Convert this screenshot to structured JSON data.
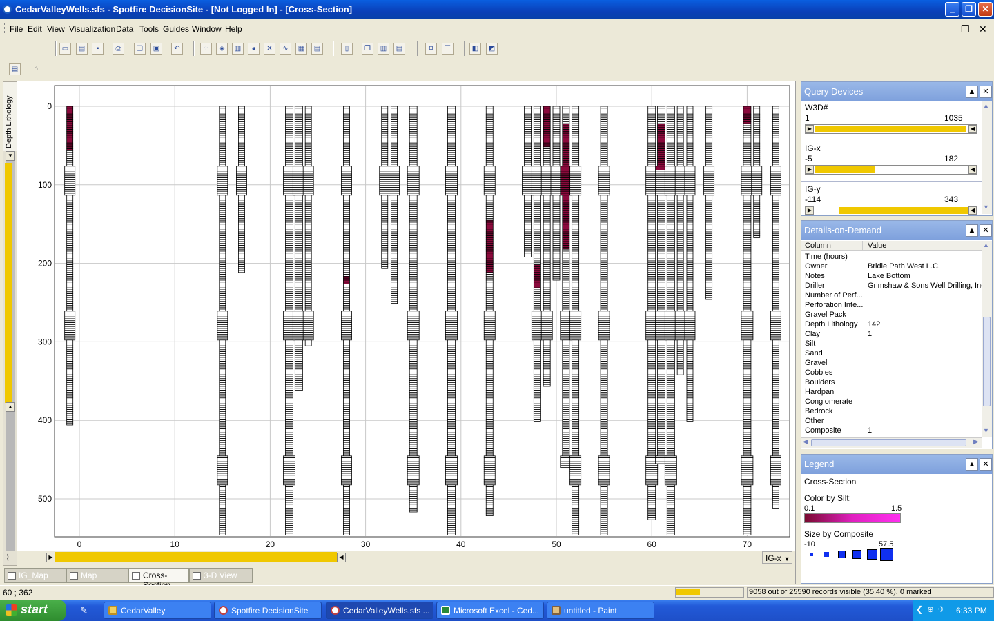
{
  "window": {
    "title": "CedarValleyWells.sfs - Spotfire DecisionSite - [Not Logged In] - [Cross-Section]"
  },
  "menu": [
    "File",
    "Edit",
    "View",
    "Visualization",
    "Data",
    "Tools",
    "Guides",
    "Window",
    "Help"
  ],
  "plot": {
    "vertical_tab": "Depth Lithology",
    "y_ticks": [
      "0",
      "100",
      "200",
      "300",
      "400",
      "500"
    ],
    "x_ticks": [
      "0",
      "10",
      "20",
      "30",
      "40",
      "50",
      "60",
      "70"
    ],
    "x_axis_selector": "IG-x",
    "colors": {
      "high_silt": "#8b0a3c",
      "grid": "#c8c8c8",
      "slider": "#f0c800"
    }
  },
  "tabs": [
    "IG_Map",
    "Map",
    "Cross-Section",
    "3-D View"
  ],
  "active_tab": "Cross-Section",
  "status": {
    "coords": "60 ; 362",
    "records": "9058 out of 25590 records visible (35.40 %), 0 marked"
  },
  "query_devices": {
    "title": "Query Devices",
    "items": [
      {
        "label": "W3D#",
        "min": "1",
        "max": "1035",
        "fill_from": 0.0,
        "fill_to": 0.99
      },
      {
        "label": "IG-x",
        "min": "-5",
        "max": "182",
        "fill_from": 0.0,
        "fill_to": 0.39
      },
      {
        "label": "IG-y",
        "min": "-114",
        "max": "343",
        "fill_from": 0.16,
        "fill_to": 1.0
      }
    ]
  },
  "details": {
    "title": "Details-on-Demand",
    "col_header": "Column",
    "val_header": "Value",
    "rows": [
      {
        "c": "Time (hours)",
        "v": ""
      },
      {
        "c": "Owner",
        "v": "Bridle Path West L.C."
      },
      {
        "c": "Notes",
        "v": "Lake Bottom"
      },
      {
        "c": "Driller",
        "v": "Grimshaw & Sons Well Drilling, Inc."
      },
      {
        "c": "Number of Perf...",
        "v": ""
      },
      {
        "c": "Perforation Inte...",
        "v": ""
      },
      {
        "c": "Gravel Pack",
        "v": ""
      },
      {
        "c": "Depth Lithology",
        "v": "142"
      },
      {
        "c": "Clay",
        "v": "1"
      },
      {
        "c": "Silt",
        "v": ""
      },
      {
        "c": "Sand",
        "v": ""
      },
      {
        "c": "Gravel",
        "v": ""
      },
      {
        "c": "Cobbles",
        "v": ""
      },
      {
        "c": "Boulders",
        "v": ""
      },
      {
        "c": "Hardpan",
        "v": ""
      },
      {
        "c": "Conglomerate",
        "v": ""
      },
      {
        "c": "Bedrock",
        "v": ""
      },
      {
        "c": "Other",
        "v": ""
      },
      {
        "c": "Composite",
        "v": "1"
      }
    ]
  },
  "legend": {
    "title": "Legend",
    "subtitle": "Cross-Section",
    "color_label": "Color by Silt:",
    "color_min": "0.1",
    "color_max": "1.5",
    "size_label": "Size by Composite",
    "size_min": "-10",
    "size_max": "57.5"
  },
  "taskbar": {
    "start": "start",
    "tasks": [
      "CedarValley",
      "Spotfire DecisionSite",
      "CedarValleyWells.sfs ...",
      "Microsoft Excel - Ced...",
      "untitled - Paint"
    ],
    "clock": "6:33 PM"
  }
}
